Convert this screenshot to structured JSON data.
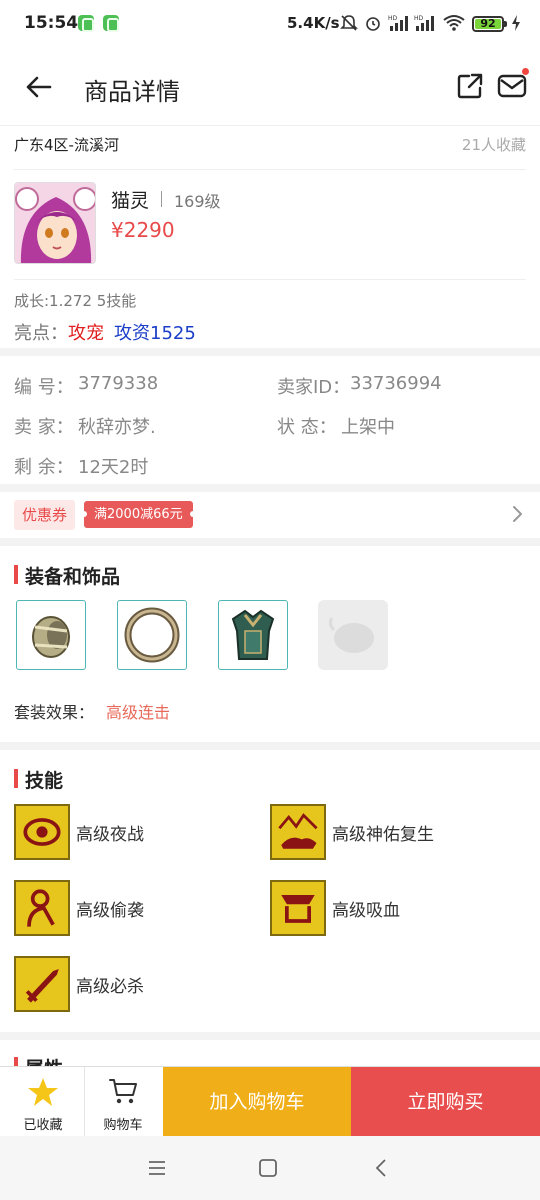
{
  "status_bar": {
    "time": "15:54",
    "net_speed": "5.4K/s",
    "battery": "92"
  },
  "header": {
    "title": "商品详情"
  },
  "listing": {
    "server": "广东4区-流溪河",
    "favorites": "21人收藏",
    "pet_name": "猫灵",
    "level": "169级",
    "price": "¥2290",
    "growth": "成长:1.272 5技能",
    "highlight_label": "亮点：",
    "highlight_1": "攻宠",
    "highlight_2": "攻资1525"
  },
  "details": {
    "id_label": "编  号：",
    "id_value": "3779338",
    "seller_id_label": "卖家ID：",
    "seller_id_value": "33736994",
    "seller_label": "卖  家：",
    "seller_value": "秋辞亦梦.",
    "status_label": "状  态：",
    "status_value": "上架中",
    "remaining_label": "剩  余：",
    "remaining_value": "12天2时"
  },
  "coupon": {
    "tag": "优惠券",
    "badge": "满2000减66元"
  },
  "equipment": {
    "title": "装备和饰品",
    "set_label": "套装效果：",
    "set_value": "高级连击"
  },
  "skills": {
    "title": "技能",
    "items": [
      {
        "label": "高级夜战",
        "icon": "night-battle-icon"
      },
      {
        "label": "高级神佑复生",
        "icon": "divine-revival-icon"
      },
      {
        "label": "高级偷袭",
        "icon": "sneak-attack-icon"
      },
      {
        "label": "高级吸血",
        "icon": "life-drain-icon"
      },
      {
        "label": "高级必杀",
        "icon": "critical-strike-icon"
      }
    ]
  },
  "attributes": {
    "title": "属性"
  },
  "bottom_bar": {
    "collected_label": "已收藏",
    "cart_label": "购物车",
    "add_to_cart": "加入购物车",
    "buy_now": "立即购买"
  },
  "colors": {
    "price": "#e84a4a",
    "add_to_cart_bg": "#f0ae18",
    "buy_bg": "#e84e4e",
    "accent": "#e84a4a"
  }
}
